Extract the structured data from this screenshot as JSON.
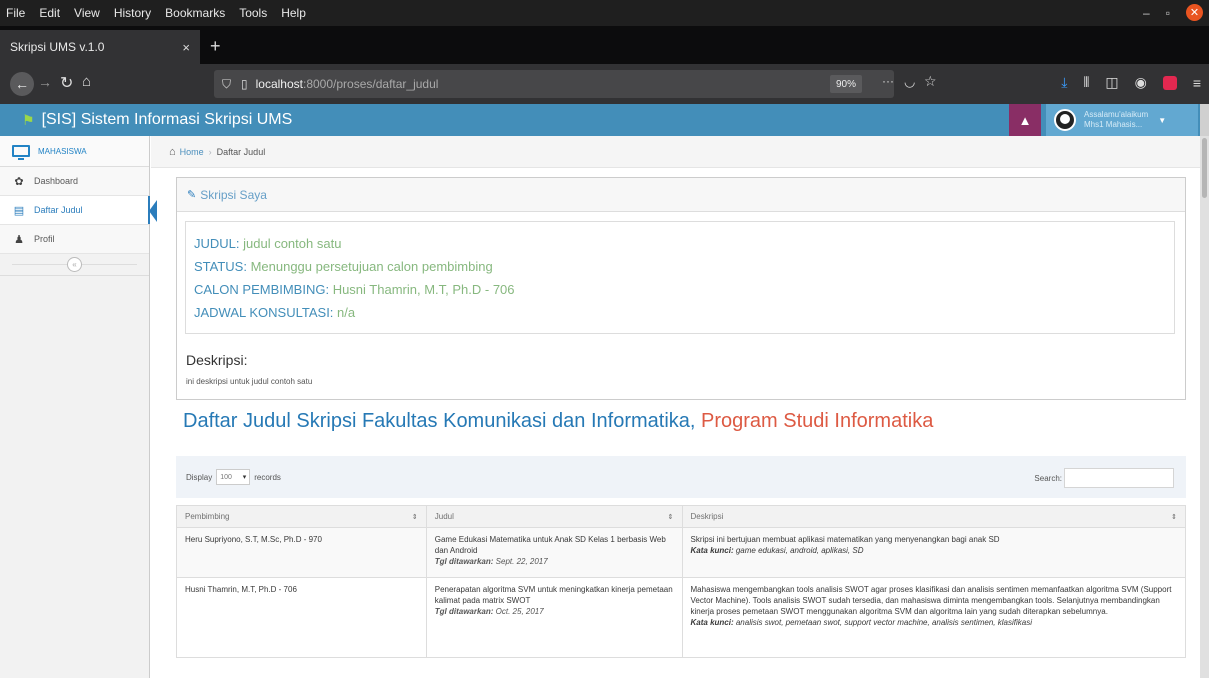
{
  "browser": {
    "menu": [
      "File",
      "Edit",
      "View",
      "History",
      "Bookmarks",
      "Tools",
      "Help"
    ],
    "tab_title": "Skripsi UMS v.1.0",
    "tab_close": "×",
    "new_tab": "+",
    "url_host": "localhost",
    "url_path": ":8000/proses/daftar_judul",
    "zoom": "90%",
    "page_actions": "···"
  },
  "app": {
    "brand": "[SIS] Sistem Informasi Skripsi UMS",
    "user_greeting": "Assalamu'alaikum",
    "user_name": "Mhs1 Mahasis...",
    "accent": "#438eb9"
  },
  "sidebar": {
    "shortcut_label": "MAHASISWA",
    "items": [
      {
        "label": "Dashboard",
        "icon": "tachometer-icon"
      },
      {
        "label": "Daftar Judul",
        "icon": "list-icon"
      },
      {
        "label": "Profil",
        "icon": "user-icon"
      }
    ],
    "collapse": "«"
  },
  "breadcrumb": {
    "home": "Home",
    "current": "Daftar Judul"
  },
  "skripsi": {
    "title": "Skripsi Saya",
    "judul_label": "JUDUL:",
    "judul_value": " judul contoh satu",
    "status_label": "STATUS:",
    "status_value": " Menunggu persetujuan calon pembimbing",
    "pembimbing_label": "CALON PEMBIMBING:",
    "pembimbing_value": " Husni Thamrin, M.T, Ph.D - 706",
    "jadwal_label": "JADWAL KONSULTASI:",
    "jadwal_value": " n/a",
    "desc_title": "Deskripsi:",
    "desc_text": "ini deskripsi untuk judul contoh satu"
  },
  "list": {
    "title_prefix": "Daftar Judul Skripsi Fakultas Komunikasi dan Informatika,",
    "title_prodi": " Program Studi Informatika",
    "display_label": "Display",
    "display_value": "100",
    "records_label": "records",
    "search_label": "Search:",
    "columns": [
      "Pembimbing",
      "Judul",
      "Deskripsi"
    ],
    "rows": [
      {
        "pembimbing": "Heru Supriyono, S.T, M.Sc, Ph.D - 970",
        "judul": "Game Edukasi Matematika untuk Anak SD Kelas 1 berbasis Web dan Android",
        "tgl_label": "Tgl ditawarkan:",
        "tgl": " Sept. 22, 2017",
        "deskripsi": "Skripsi ini bertujuan membuat aplikasi matematikan yang menyenangkan bagi anak SD",
        "kw_label": "Kata kunci:",
        "kw": " game edukasi, android, aplikasi, SD"
      },
      {
        "pembimbing": "Husni Thamrin, M.T, Ph.D - 706",
        "judul": "Penerapatan algoritma SVM untuk meningkatkan kinerja pemetaan kalimat pada matrix SWOT",
        "tgl_label": "Tgl ditawarkan:",
        "tgl": " Oct. 25, 2017",
        "deskripsi": "Mahasiswa mengembangkan tools analisis SWOT agar proses klasifikasi dan analisis sentimen memanfaatkan algoritma SVM (Support Vector Machine). Tools analisis SWOT sudah tersedia, dan mahasiswa diminta mengembangkan tools. Selanjutnya membandingkan kinerja proses pemetaan SWOT menggunakan algoritma SVM dan algoritma lain yang sudah diterapkan sebelumnya.",
        "kw_label": "Kata kunci:",
        "kw": " analisis swot, pemetaan swot, support vector machine, analisis sentimen, klasifikasi"
      }
    ]
  }
}
